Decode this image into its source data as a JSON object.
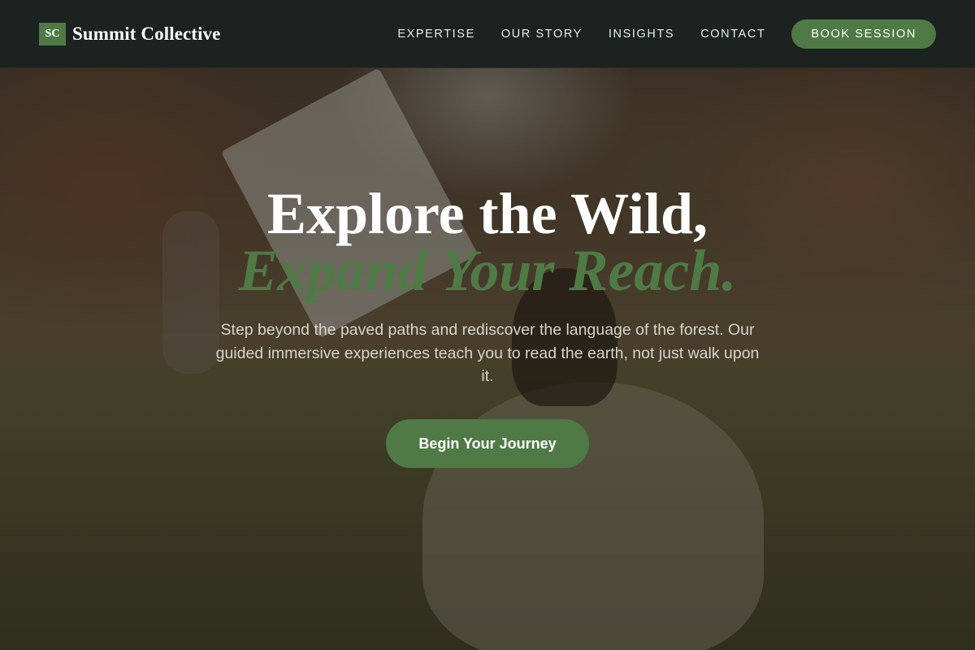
{
  "brand": {
    "logo_initials": "SC",
    "name": "Summit Collective"
  },
  "nav": {
    "links": [
      "EXPERTISE",
      "OUR STORY",
      "INSIGHTS",
      "CONTACT"
    ],
    "cta_label": "BOOK SESSION"
  },
  "hero": {
    "headline_line1": "Explore the Wild,",
    "headline_line2": "Expand Your Reach.",
    "subtext": "Step beyond the paved paths and rediscover the language of the forest. Our guided immersive experiences teach you to read the earth, not just walk upon it.",
    "cta_label": "Begin Your Journey",
    "background_image": "person sitting on grass holding up an open book in a park"
  },
  "colors": {
    "accent": "#4f7a45",
    "nav_background": "#1c2220",
    "text_light": "#ffffff"
  }
}
